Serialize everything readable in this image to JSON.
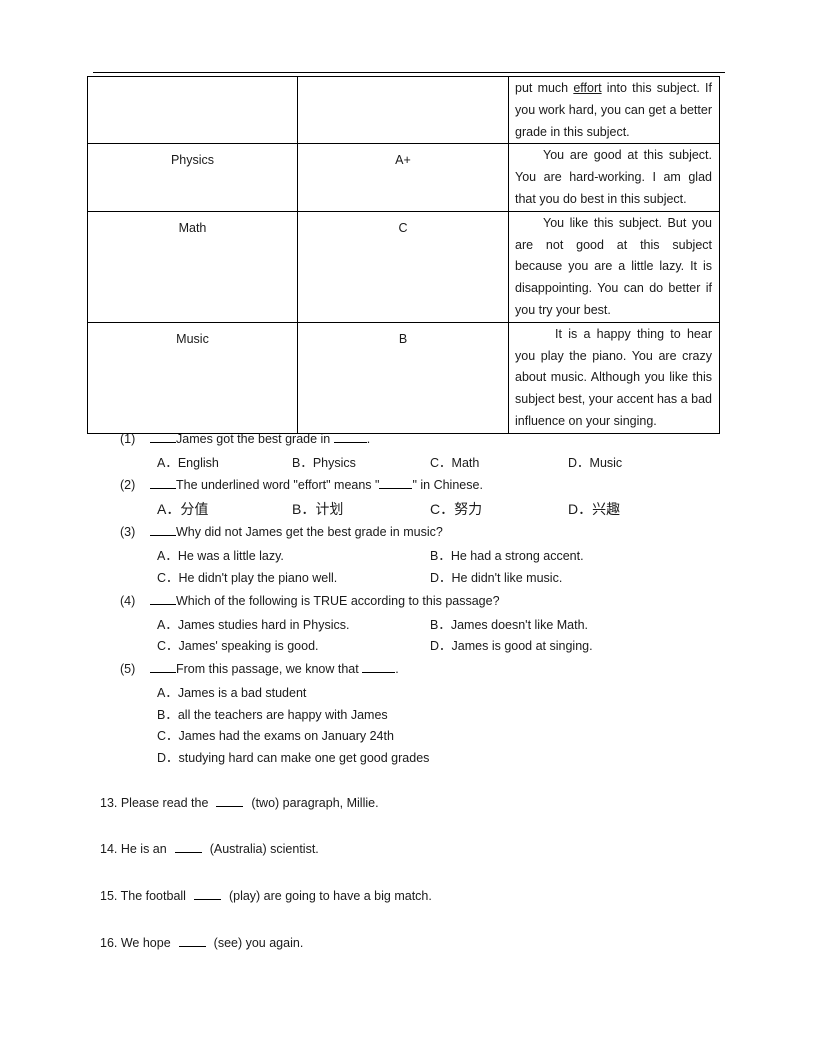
{
  "table": {
    "rows": [
      {
        "subject": "",
        "grade": "",
        "comment_pre": "put much ",
        "comment_underlined": "effort",
        "comment_post": " into this subject. If you work hard, you can get a better grade in this subject."
      },
      {
        "subject": "Physics",
        "grade": "A+",
        "comment": "You are good at this subject. You are hard-working. I am glad that you do best in this subject."
      },
      {
        "subject": "Math",
        "grade": "C",
        "comment": "You like this subject. But you are not good at this subject because you are a little lazy. It is disappointing. You can do better if you try your best."
      },
      {
        "subject": "Music",
        "grade": "B",
        "comment": "It is a happy thing to hear you play the piano. You are crazy about music. Although you like this subject best, your accent has a bad influence on your singing."
      }
    ]
  },
  "questions": [
    {
      "number": "(1)",
      "stem_pre": "James got the best grade in ",
      "stem_post": ".",
      "options": [
        "A．English",
        "B．Physics",
        "C．Math",
        "D．Music"
      ]
    },
    {
      "number": "(2)",
      "stem_pre": "The underlined word \"effort\" means \"",
      "stem_post": "\" in Chinese.",
      "options": [
        "A．分值",
        "B．计划",
        "C．努力",
        "D．兴趣"
      ]
    },
    {
      "number": "(3)",
      "stem": "Why did not James get the best grade in music?",
      "options": [
        "A．He was a little lazy.",
        "B．He had a strong accent.",
        "C．He didn't play the piano well.",
        "D．He didn't like music."
      ]
    },
    {
      "number": "(4)",
      "stem": "Which of the following is TRUE according to this passage?",
      "options": [
        "A．James studies hard in Physics.",
        "B．James doesn't like Math.",
        "C．James' speaking is good.",
        "D．James is good at singing."
      ]
    },
    {
      "number": "(5)",
      "stem_pre": "From this passage, we know that ",
      "stem_post": ".",
      "options": [
        "A．James is a bad student",
        "B．all the teachers are happy with James",
        "C．James had the exams on January 24th",
        "D．studying hard can make one get good grades"
      ]
    }
  ],
  "fill_in": [
    {
      "pre": "13. Please read the",
      "post": "(two) paragraph, Millie."
    },
    {
      "pre": "14. He is an",
      "post": "(Australia) scientist."
    },
    {
      "pre": "15. The football",
      "post": "(play) are going to have a big match."
    },
    {
      "pre": "16. We hope",
      "post": "(see) you again."
    }
  ]
}
